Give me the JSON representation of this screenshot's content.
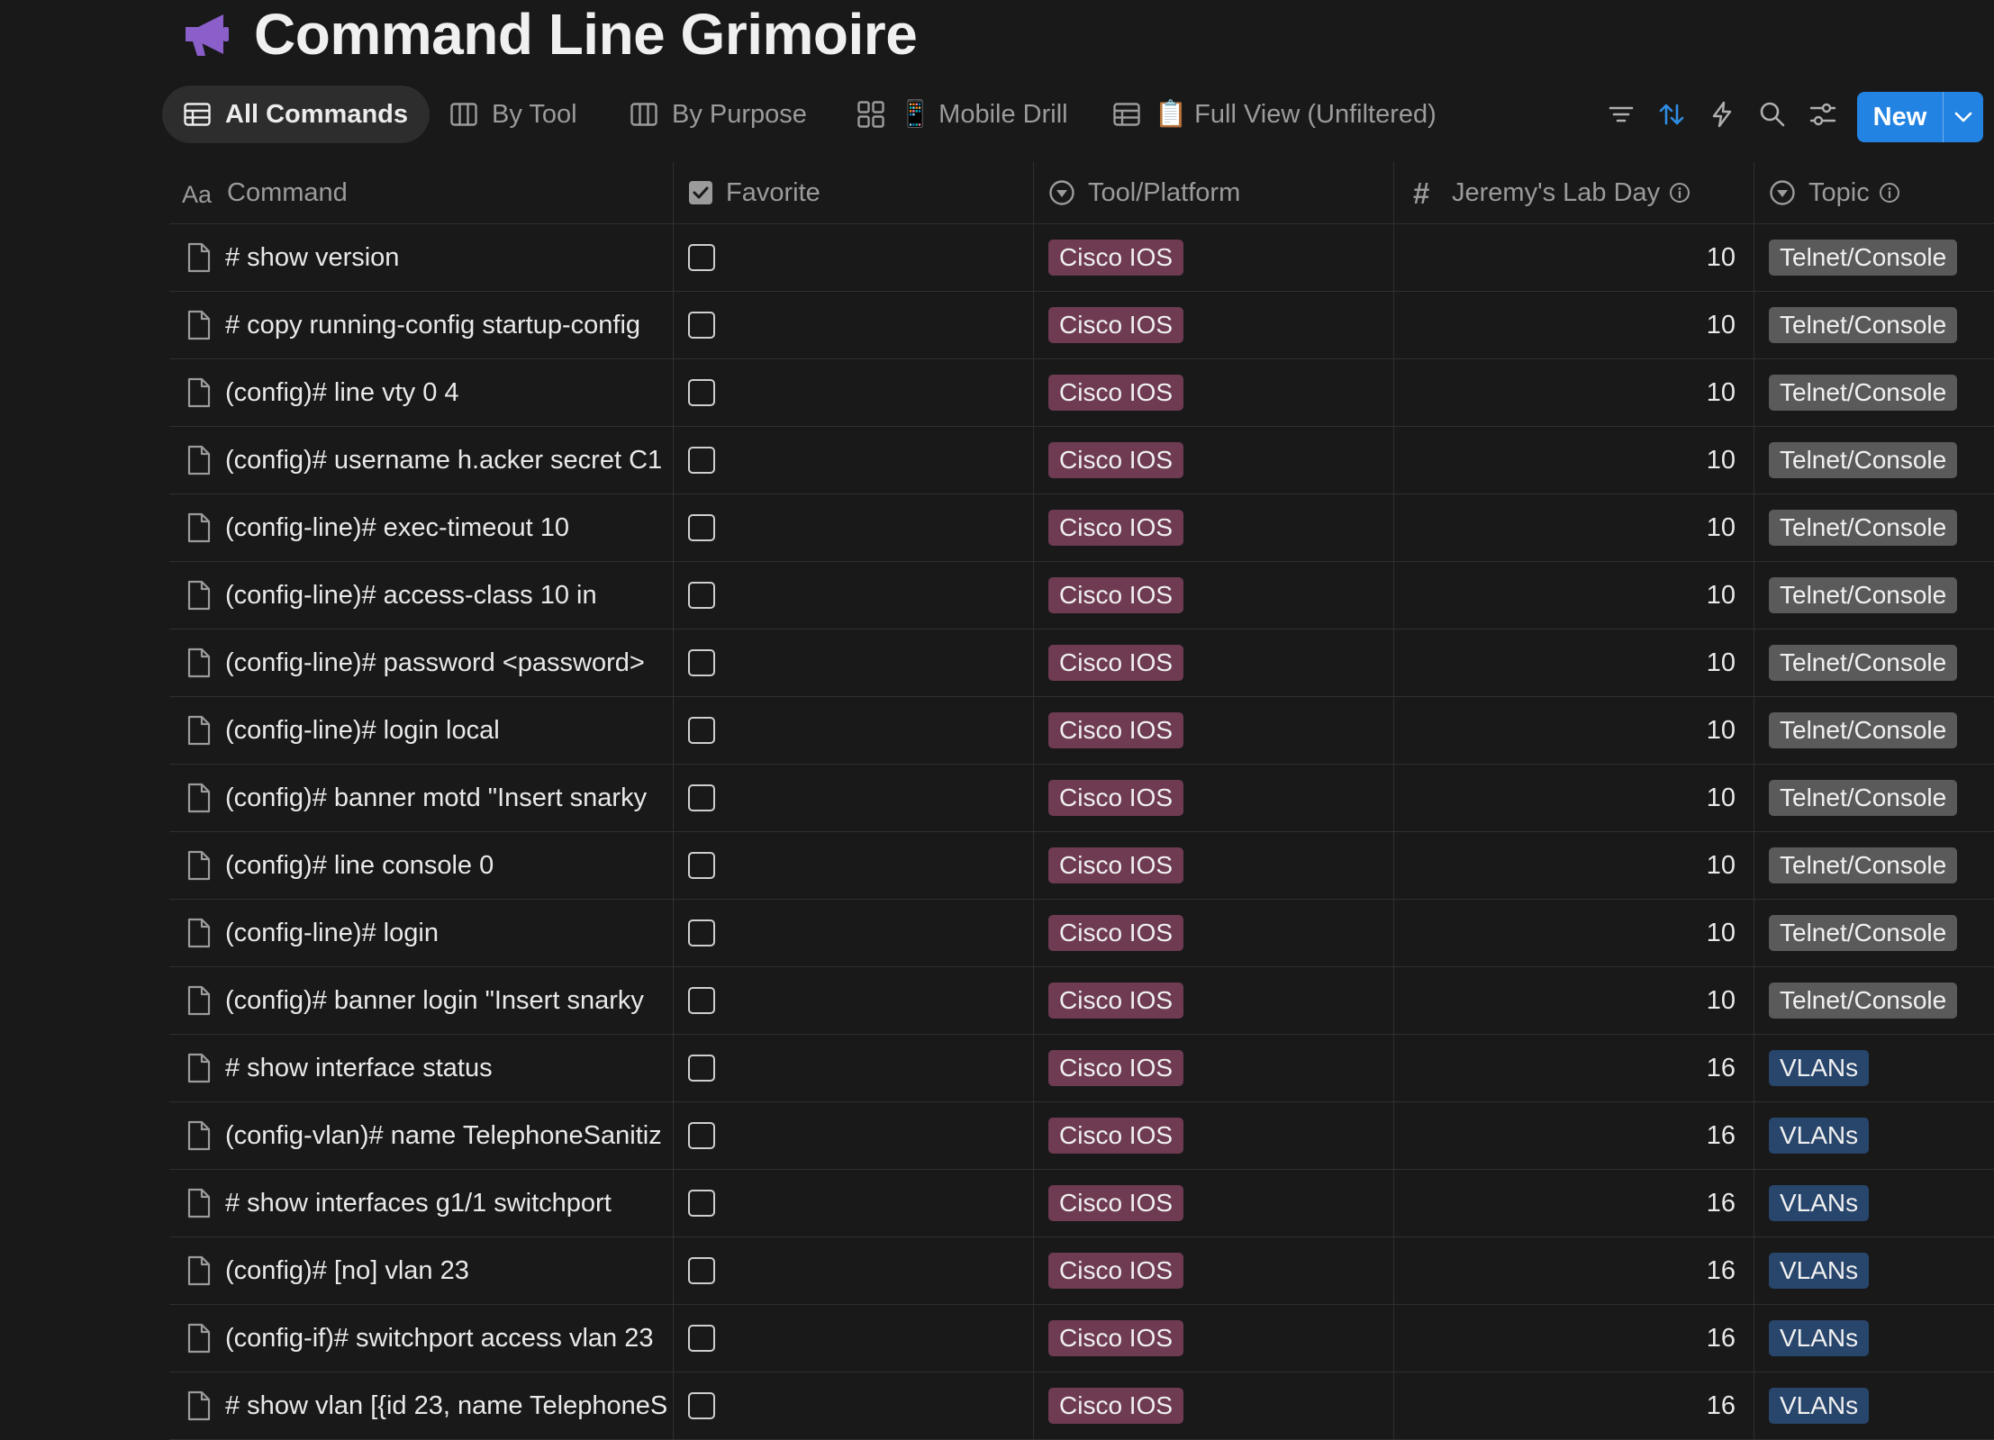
{
  "page": {
    "title": "Command Line Grimoire",
    "icon": "megaphone-icon"
  },
  "views": [
    {
      "label": "All Commands",
      "icon": "table-icon",
      "active": true
    },
    {
      "label": "By Tool",
      "icon": "board-icon"
    },
    {
      "label": "By Purpose",
      "icon": "board-icon"
    },
    {
      "label": "📱 Mobile Drill",
      "icon": "gallery-icon"
    },
    {
      "label": "📋 Full View (Unfiltered)",
      "icon": "table-icon"
    }
  ],
  "toolbar": {
    "icons": [
      "filter-icon",
      "sort-icon",
      "lightning-icon",
      "search-icon",
      "settings-icon"
    ],
    "new_label": "New",
    "accent": "#2383e2"
  },
  "columns": [
    {
      "label": "Command",
      "icon": "text-property-icon"
    },
    {
      "label": "Favorite",
      "icon": "checkbox-property-icon"
    },
    {
      "label": "Tool/Platform",
      "icon": "select-property-icon"
    },
    {
      "label": "Jeremy's Lab Day",
      "icon": "number-property-icon",
      "info": true
    },
    {
      "label": "Topic",
      "icon": "select-property-icon",
      "info": true
    }
  ],
  "tag_colors": {
    "Cisco IOS": "#6e3b52",
    "Telnet/Console": "#5a5a5a",
    "VLANs": "#28456c"
  },
  "rows": [
    {
      "command": "# show version",
      "favorite": false,
      "tool": "Cisco IOS",
      "day": "10",
      "topic": "Telnet/Console"
    },
    {
      "command": "# copy running-config startup-config",
      "favorite": false,
      "tool": "Cisco IOS",
      "day": "10",
      "topic": "Telnet/Console"
    },
    {
      "command": "(config)# line vty 0 4",
      "favorite": false,
      "tool": "Cisco IOS",
      "day": "10",
      "topic": "Telnet/Console"
    },
    {
      "command": "(config)# username h.acker secret C1",
      "favorite": false,
      "tool": "Cisco IOS",
      "day": "10",
      "topic": "Telnet/Console"
    },
    {
      "command": "(config-line)# exec-timeout 10",
      "favorite": false,
      "tool": "Cisco IOS",
      "day": "10",
      "topic": "Telnet/Console"
    },
    {
      "command": "(config-line)# access-class 10 in",
      "favorite": false,
      "tool": "Cisco IOS",
      "day": "10",
      "topic": "Telnet/Console"
    },
    {
      "command": "(config-line)# password <password>",
      "favorite": false,
      "tool": "Cisco IOS",
      "day": "10",
      "topic": "Telnet/Console"
    },
    {
      "command": "(config-line)# login local",
      "favorite": false,
      "tool": "Cisco IOS",
      "day": "10",
      "topic": "Telnet/Console"
    },
    {
      "command": "(config)# banner motd \"Insert snarky",
      "favorite": false,
      "tool": "Cisco IOS",
      "day": "10",
      "topic": "Telnet/Console"
    },
    {
      "command": "(config)# line console 0",
      "favorite": false,
      "tool": "Cisco IOS",
      "day": "10",
      "topic": "Telnet/Console"
    },
    {
      "command": "(config-line)# login",
      "favorite": false,
      "tool": "Cisco IOS",
      "day": "10",
      "topic": "Telnet/Console"
    },
    {
      "command": "(config)# banner login \"Insert snarky",
      "favorite": false,
      "tool": "Cisco IOS",
      "day": "10",
      "topic": "Telnet/Console"
    },
    {
      "command": "# show interface status",
      "favorite": false,
      "tool": "Cisco IOS",
      "day": "16",
      "topic": "VLANs"
    },
    {
      "command": "(config-vlan)# name TelephoneSanitiz",
      "favorite": false,
      "tool": "Cisco IOS",
      "day": "16",
      "topic": "VLANs"
    },
    {
      "command": "# show interfaces g1/1 switchport",
      "favorite": false,
      "tool": "Cisco IOS",
      "day": "16",
      "topic": "VLANs"
    },
    {
      "command": "(config)# [no] vlan 23",
      "favorite": false,
      "tool": "Cisco IOS",
      "day": "16",
      "topic": "VLANs"
    },
    {
      "command": "(config-if)# switchport access vlan 23",
      "favorite": false,
      "tool": "Cisco IOS",
      "day": "16",
      "topic": "VLANs"
    },
    {
      "command": "# show vlan [{id 23, name TelephoneS",
      "favorite": false,
      "tool": "Cisco IOS",
      "day": "16",
      "topic": "VLANs"
    }
  ]
}
